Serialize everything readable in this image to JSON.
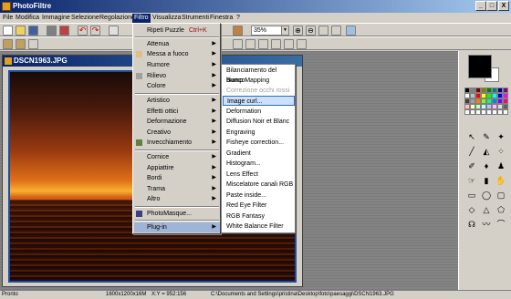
{
  "app": {
    "title": "PhotoFiltre"
  },
  "window_controls": {
    "min": "_",
    "max": "□",
    "close": "X"
  },
  "menubar": [
    "File",
    "Modifica",
    "Immagine",
    "Selezione",
    "Regolazione",
    "Filtro",
    "Visualizza",
    "Strumenti",
    "Finestra",
    "?"
  ],
  "toolbar": {
    "zoom": "35%"
  },
  "document": {
    "title": "DSCN1963.JPG"
  },
  "filtro_menu": {
    "items": [
      {
        "label": "Ripeti Puzzle",
        "shortcut": "Ctrl+K"
      },
      {
        "label": "Attenua"
      },
      {
        "label": "Messa a fuoco"
      },
      {
        "label": "Rumore"
      },
      {
        "label": "Rilievo"
      },
      {
        "label": "Colore"
      },
      {
        "label": "Artistico"
      },
      {
        "label": "Effetti ottici"
      },
      {
        "label": "Deformazione"
      },
      {
        "label": "Creativo"
      },
      {
        "label": "Invecchiamento"
      },
      {
        "label": "Cornice"
      },
      {
        "label": "Appiattire"
      },
      {
        "label": "Bordi"
      },
      {
        "label": "Trama"
      },
      {
        "label": "Altro"
      },
      {
        "label": "PhotoMasque..."
      },
      {
        "label": "Plug-in"
      }
    ]
  },
  "plugin_menu": {
    "items": [
      {
        "label": "Bilanciamento del bianco"
      },
      {
        "label": "Bump Mapping"
      },
      {
        "label": "Correzione occhi rossi"
      },
      {
        "label": "Image curl..."
      },
      {
        "label": "Deformation"
      },
      {
        "label": "Diffusion Noir et Blanc"
      },
      {
        "label": "Engraving"
      },
      {
        "label": "Fisheye correction..."
      },
      {
        "label": "Gradient"
      },
      {
        "label": "Histogram..."
      },
      {
        "label": "Lens Effect"
      },
      {
        "label": "Miscelatore canali RGB"
      },
      {
        "label": "Paste inside..."
      },
      {
        "label": "Red Eye Filter"
      },
      {
        "label": "RGB Fantasy"
      },
      {
        "label": "White Balance Filter"
      }
    ]
  },
  "status": {
    "state": "Pronto",
    "size": "1600x1200x16M",
    "coords": "X:Y = 952:156",
    "path": "C:\\Documents and Settings\\pristina\\Desktop\\foto\\paesaggi\\DSCN1963.JPG"
  },
  "colors": {
    "accent": "#0a246a",
    "menu_bg": "#d4d0c8",
    "highlight": "#a0b4d8"
  }
}
